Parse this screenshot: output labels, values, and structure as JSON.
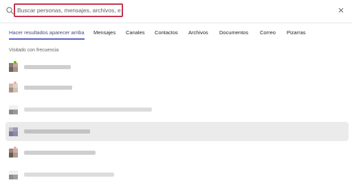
{
  "search": {
    "placeholder": "Buscar personas, mensajes, archivos, etc.",
    "value": ""
  },
  "tabs": [
    {
      "label": "Hacer resultados aparecer arriba",
      "active": true
    },
    {
      "label": "Mensajes",
      "active": false
    },
    {
      "label": "Canales",
      "active": false
    },
    {
      "label": "Contactos",
      "active": false
    },
    {
      "label": "Archivos",
      "active": false
    },
    {
      "label": "Documentos",
      "active": false
    },
    {
      "label": "Correo",
      "active": false
    },
    {
      "label": "Pizarras",
      "active": false
    }
  ],
  "section": {
    "label": "Visitado con frecuencia"
  },
  "results": [
    {
      "icon": "person-avatar-icon",
      "status": "available",
      "highlighted": false
    },
    {
      "icon": "person-avatar-icon",
      "status": "away",
      "highlighted": false
    },
    {
      "icon": "group-avatar-icon",
      "status": "none",
      "highlighted": false
    },
    {
      "icon": "group-avatar-icon",
      "status": "none",
      "highlighted": true
    },
    {
      "icon": "person-avatar-icon",
      "status": "away",
      "highlighted": false
    },
    {
      "icon": "group-avatar-icon",
      "status": "none",
      "highlighted": false
    }
  ],
  "colors": {
    "accent": "#5b5fc7",
    "focus_border": "#c4314b",
    "hover_row": "#ebebeb"
  }
}
